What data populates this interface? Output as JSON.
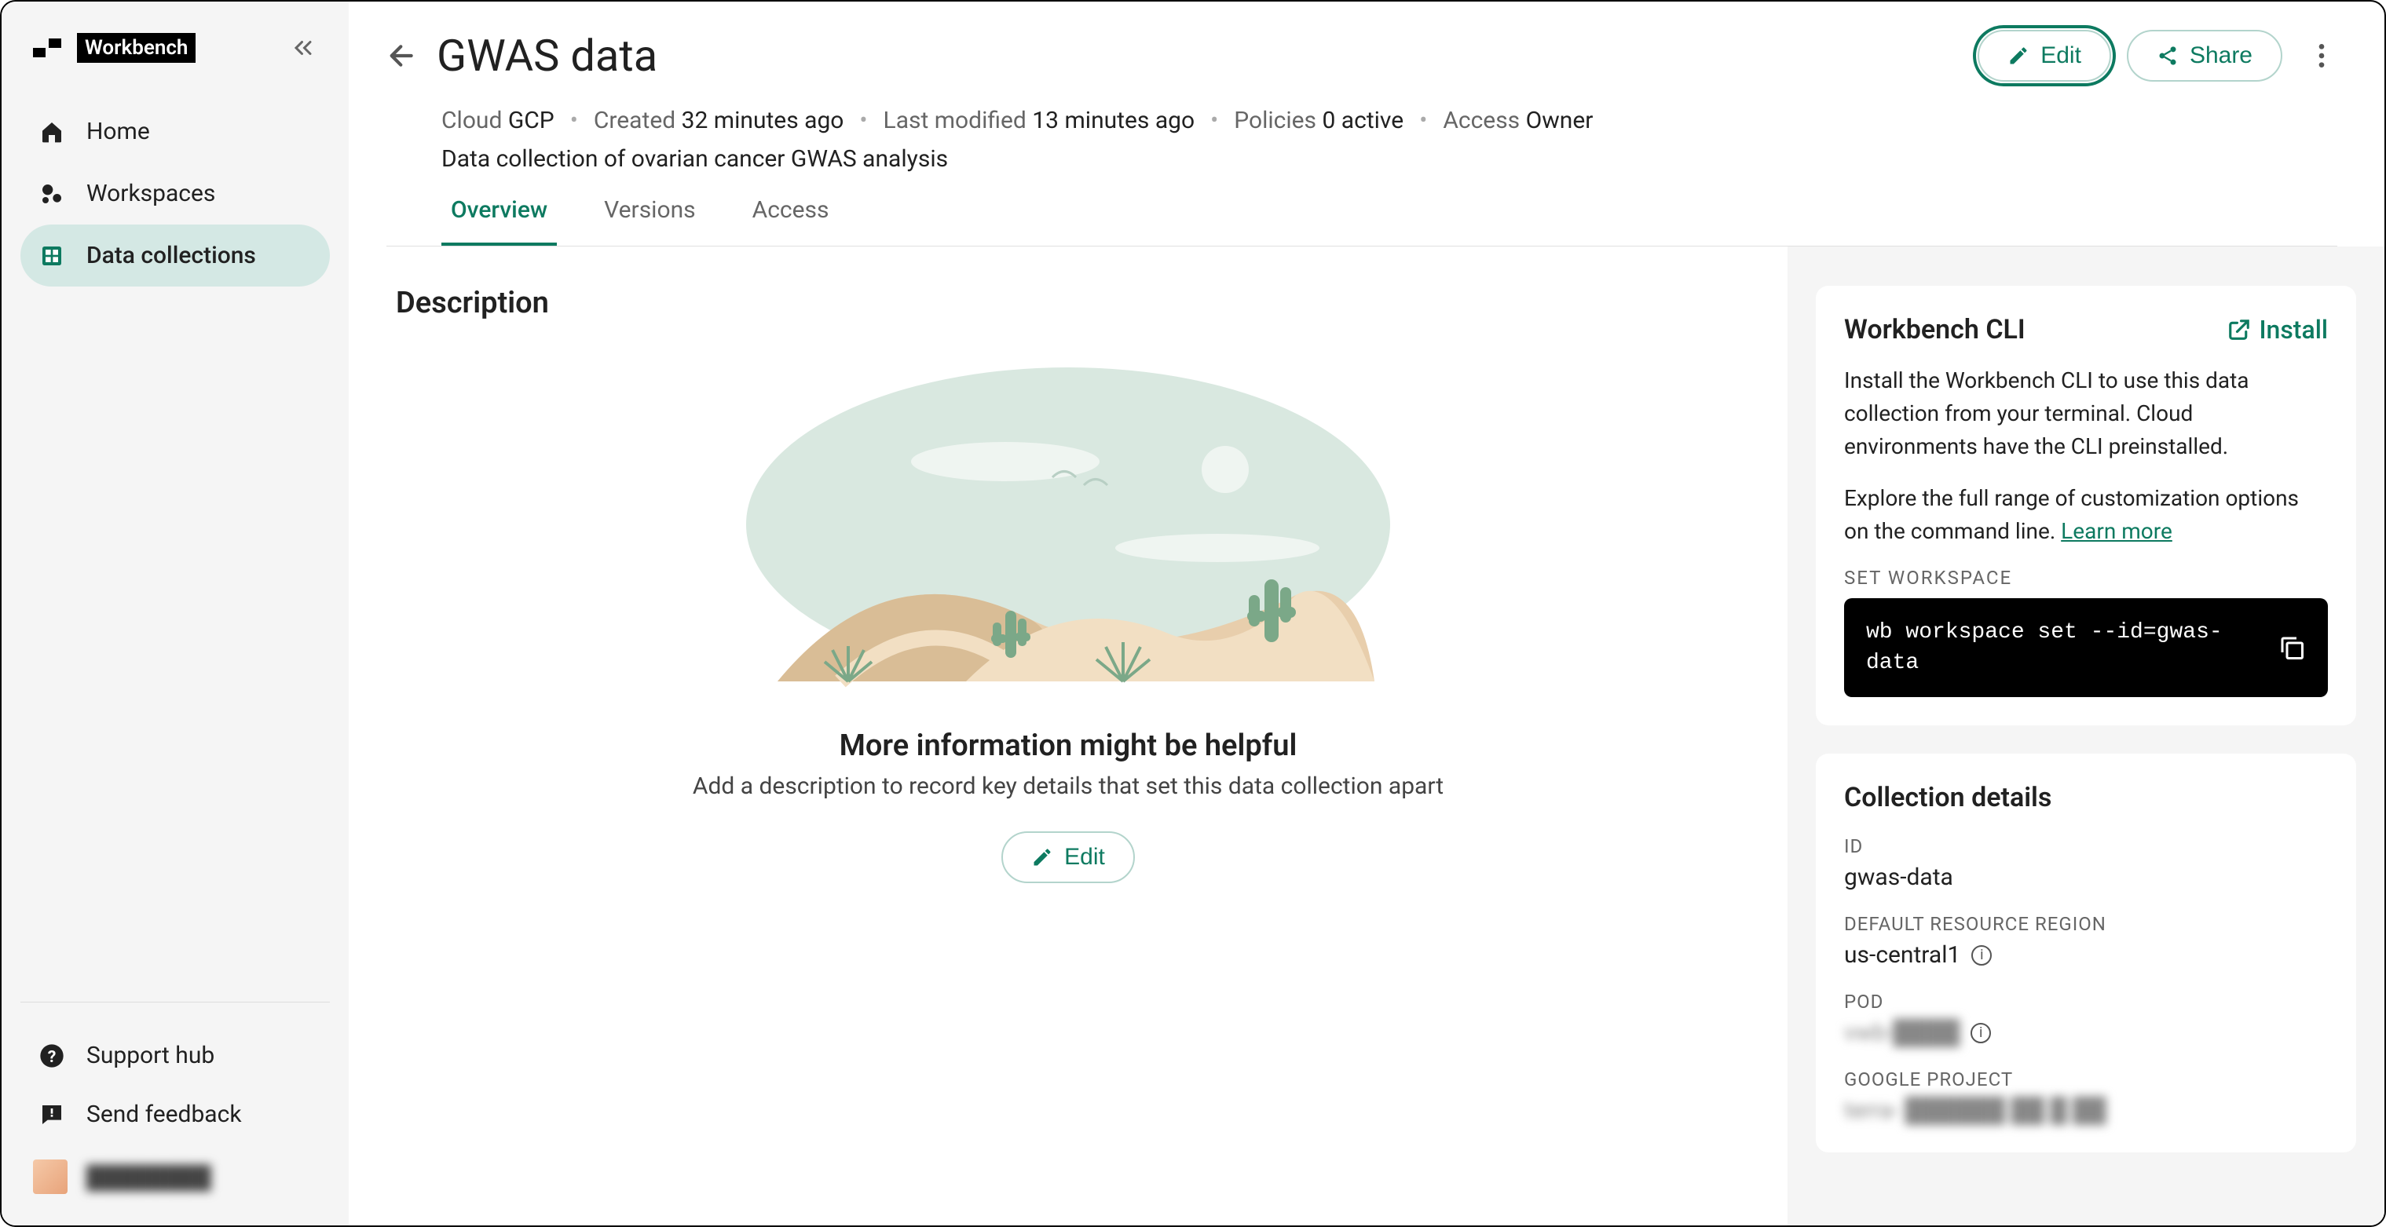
{
  "app": {
    "name": "Workbench"
  },
  "sidebar": {
    "items": [
      {
        "label": "Home"
      },
      {
        "label": "Workspaces"
      },
      {
        "label": "Data collections"
      }
    ],
    "footer": {
      "support": "Support hub",
      "feedback": "Send feedback",
      "user": "████████"
    }
  },
  "header": {
    "title": "GWAS data",
    "edit": "Edit",
    "share": "Share",
    "meta": {
      "cloud_label": "Cloud",
      "cloud_value": "GCP",
      "created_label": "Created",
      "created_value": "32 minutes ago",
      "modified_label": "Last modified",
      "modified_value": "13 minutes ago",
      "policies_label": "Policies",
      "policies_value": "0 active",
      "access_label": "Access",
      "access_value": "Owner"
    },
    "description": "Data collection of ovarian cancer GWAS analysis",
    "tabs": [
      {
        "label": "Overview"
      },
      {
        "label": "Versions"
      },
      {
        "label": "Access"
      }
    ]
  },
  "description_section": {
    "title": "Description",
    "empty_title": "More information might be helpful",
    "empty_sub": "Add a description to record key details that set this data collection apart",
    "edit": "Edit"
  },
  "cli": {
    "title": "Workbench CLI",
    "install": "Install",
    "text1": "Install the Workbench CLI to use this data collection from your terminal. Cloud environments have the CLI preinstalled.",
    "text2": "Explore the full range of customization options on the command line. ",
    "learn_more": "Learn more",
    "set_workspace_label": "SET WORKSPACE",
    "command": "wb workspace set --id=gwas-data"
  },
  "details": {
    "title": "Collection details",
    "id_label": "ID",
    "id_value": "gwas-data",
    "region_label": "DEFAULT RESOURCE REGION",
    "region_value": "us-central1",
    "pod_label": "POD",
    "pod_value": "vwb-████",
    "project_label": "GOOGLE PROJECT",
    "project_value": "terra- ██████ ██ █ ██"
  }
}
